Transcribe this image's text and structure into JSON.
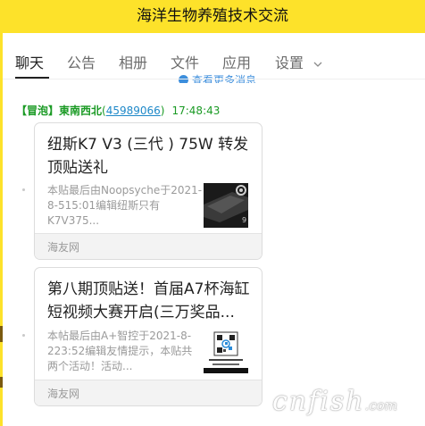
{
  "window": {
    "title": "海洋生物养殖技术交流"
  },
  "tabs": [
    {
      "label": "聊天",
      "active": true
    },
    {
      "label": "公告"
    },
    {
      "label": "相册"
    },
    {
      "label": "文件"
    },
    {
      "label": "应用"
    },
    {
      "label": "设置"
    }
  ],
  "chat": {
    "more_messages": "查看更多消息",
    "message": {
      "tag": "【冒泡】",
      "sender_name": "東南西北",
      "open_paren": "(",
      "sender_id": "45989066",
      "close_paren": ")",
      "time": "17:48:43"
    },
    "cards": [
      {
        "title": "纽斯K7 V3 (三代 ) 75W 转发顶贴送礼",
        "description": "本贴最后由Noopsyche于2021-8-515:01编辑纽斯只有K7V375...",
        "source": "海友网",
        "thumbnail_icon": "aquarium-light-product-photo-icon"
      },
      {
        "title": "第八期顶贴送！首届A7杯海缸短视频大赛开启(三万奖品...",
        "description": "本帖最后由A+智控于2021-8-223:52编辑友情提示，本贴共两个活动！活动...",
        "source": "海友网",
        "thumbnail_icon": "contest-qr-poster-icon"
      }
    ]
  },
  "watermark": {
    "main": "cnfish",
    "suffix": ".com"
  },
  "colors": {
    "title_bar": "#fde22a",
    "sender_green": "#1a9a24",
    "link_blue": "#1e88c8",
    "accent_blue": "#3c8edc"
  }
}
